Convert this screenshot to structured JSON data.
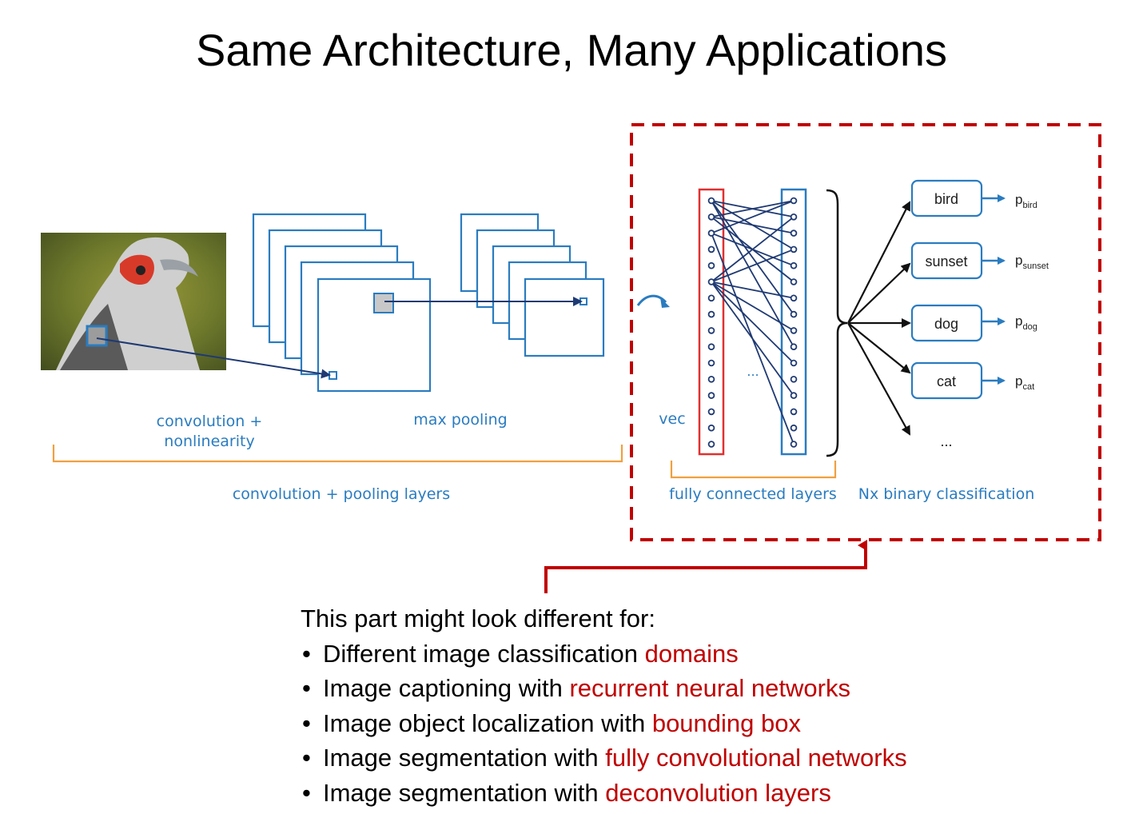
{
  "title": "Same Architecture, Many Applications",
  "diagram": {
    "labels": {
      "conv": [
        "convolution +",
        "nonlinearity"
      ],
      "pool": "max pooling",
      "conv_pool_layers": "convolution + pooling layers",
      "vec": "vec",
      "dots": "...",
      "fc_layers": "fully connected layers",
      "nx_binary": "Nx binary classification",
      "more": "..."
    },
    "classes": [
      {
        "name": "bird",
        "prob": "p",
        "sub": "bird"
      },
      {
        "name": "sunset",
        "prob": "p",
        "sub": "sunset"
      },
      {
        "name": "dog",
        "prob": "p",
        "sub": "dog"
      },
      {
        "name": "cat",
        "prob": "p",
        "sub": "cat"
      }
    ],
    "colors": {
      "blue": "#2a7cc0",
      "navy": "#1f3a73",
      "orange": "#f0a040",
      "red": "#c00000"
    }
  },
  "intro": "This part might look different for:",
  "bullets": [
    {
      "text": "Different image classification ",
      "red": "domains"
    },
    {
      "text": "Image captioning with ",
      "red": "recurrent neural networks"
    },
    {
      "text": "Image object localization with ",
      "red": "bounding box"
    },
    {
      "text": "Image segmentation with ",
      "red": "fully convolutional networks"
    },
    {
      "text": "Image segmentation with ",
      "red": "deconvolution layers"
    }
  ]
}
